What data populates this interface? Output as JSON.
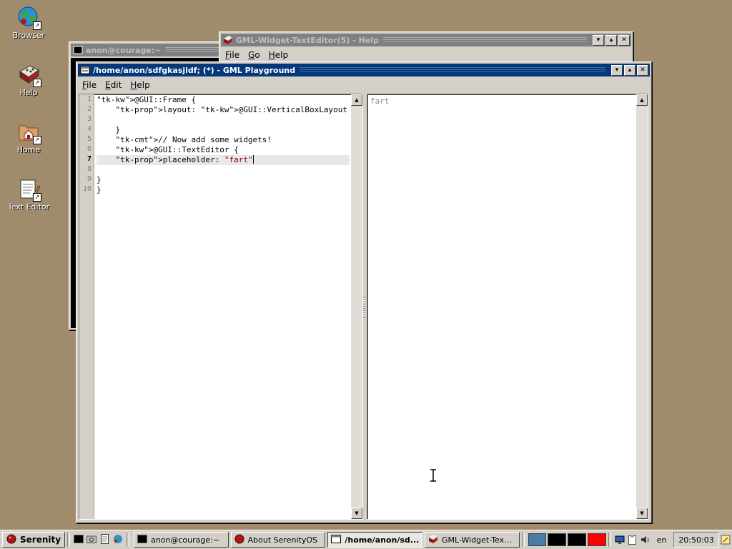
{
  "desktop": {
    "icons": [
      {
        "label": "Browser",
        "icon": "globe-icon"
      },
      {
        "label": "Help",
        "icon": "book-icon"
      },
      {
        "label": "Home",
        "icon": "home-folder-icon"
      },
      {
        "label": "Text Editor",
        "icon": "notepad-icon"
      }
    ]
  },
  "terminal_window": {
    "title": "anon@courage:~"
  },
  "help_window": {
    "title": "GML-Widget-TextEditor(5) - Help",
    "menu": [
      "File",
      "Go",
      "Help"
    ],
    "menu_underline": [
      "F",
      "G",
      "H"
    ]
  },
  "playground_window": {
    "title": "/home/anon/sdfgkasjldf; (*) - GML Playground",
    "menu": [
      "File",
      "Edit",
      "Help"
    ],
    "menu_underline": [
      "F",
      "E",
      "H"
    ],
    "current_line": 7,
    "code": [
      "@GUI::Frame {",
      "    layout: @GUI::VerticalBoxLayout {",
      "",
      "    }",
      "    // Now add some widgets!",
      "    @GUI::TextEditor {",
      "    placeholder: \"fart\"",
      "",
      "}",
      "}"
    ],
    "line_numbers": [
      "1",
      "2",
      "3",
      "4",
      "5",
      "6",
      "7",
      "8",
      "9",
      "10"
    ],
    "preview_placeholder": "fart"
  },
  "taskbar": {
    "start_label": "Serenity",
    "tasks": [
      {
        "label": "anon@courage:~",
        "icon": "terminal-icon",
        "active": false
      },
      {
        "label": "About SerenityOS",
        "icon": "serenity-icon",
        "active": false
      },
      {
        "label": "/home/anon/sd...",
        "icon": "gml-playground-icon",
        "active": true
      },
      {
        "label": "GML-Widget-Tex...",
        "icon": "book-icon",
        "active": false
      }
    ],
    "keymap": "en",
    "clock": "20:50:03",
    "colors": {
      "ws1": "#4a7ca8",
      "ws2": "#000000",
      "ws3": "#000000",
      "ws4": "#ff0000"
    }
  }
}
